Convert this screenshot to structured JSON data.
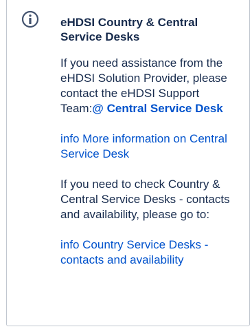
{
  "panel": {
    "icon": "info-icon",
    "title": "eHDSI Country & Central Service Desks",
    "p1_text": "If you need assistance from the eHDSI Solution Provider, please contact the eHDSI Support Team:",
    "p1_link": "@ Central Service Desk",
    "link_more_info": "info More information on Central Service Desk",
    "p2_text": "If you need to check Country & Central Service Desks - contacts and availability, please go to:",
    "link_country": "info Country Service Desks - contacts and availability"
  },
  "colors": {
    "link": "#0052cc",
    "text": "#172b4d",
    "border": "#c1c7d0"
  }
}
